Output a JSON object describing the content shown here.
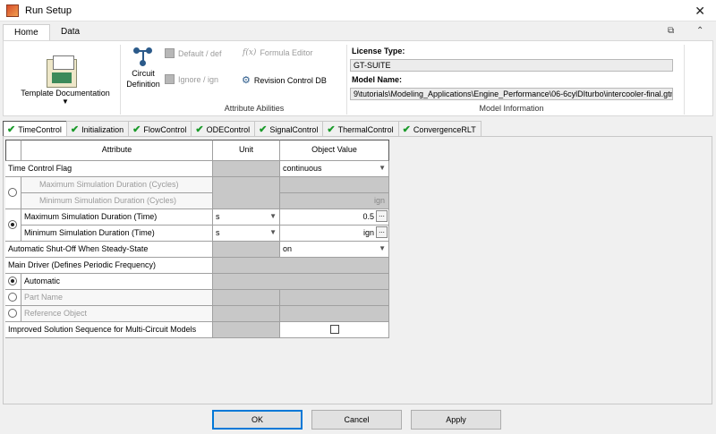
{
  "window": {
    "title": "Run Setup"
  },
  "ribbon_tabs": [
    {
      "label": "Home"
    },
    {
      "label": "Data"
    }
  ],
  "ribbon": {
    "template_doc": "Template Documentation",
    "circuit_def_line1": "Circuit",
    "circuit_def_line2": "Definition",
    "default_def": "Default / def",
    "ignore_ign": "Ignore / ign",
    "formula_editor": "Formula Editor",
    "revision_control": "Revision Control DB",
    "attribute_abilities": "Attribute Abilities",
    "license_type_label": "License Type:",
    "license_type_value": "GT-SUITE",
    "model_name_label": "Model Name:",
    "model_name_value": "9\\tutorials\\Modeling_Applications\\Engine_Performance\\06-6cylDIturbo\\intercooler-final.gtm",
    "model_information": "Model Information"
  },
  "subtabs": [
    {
      "label": "TimeControl"
    },
    {
      "label": "Initialization"
    },
    {
      "label": "FlowControl"
    },
    {
      "label": "ODEControl"
    },
    {
      "label": "SignalControl"
    },
    {
      "label": "ThermalControl"
    },
    {
      "label": "ConvergenceRLT"
    }
  ],
  "table": {
    "headers": {
      "attribute": "Attribute",
      "unit": "Unit",
      "value": "Object Value"
    },
    "rows": {
      "time_control_flag": {
        "label": "Time Control Flag",
        "value": "continuous"
      },
      "max_sim_cycles": {
        "label": "Maximum Simulation Duration (Cycles)"
      },
      "min_sim_cycles": {
        "label": "Minimum Simulation Duration (Cycles)",
        "value": "ign"
      },
      "max_sim_time": {
        "label": "Maximum Simulation Duration (Time)",
        "unit": "s",
        "value": "0.5"
      },
      "min_sim_time": {
        "label": "Minimum Simulation Duration (Time)",
        "unit": "s",
        "value": "ign"
      },
      "auto_shutoff": {
        "label": "Automatic Shut-Off When Steady-State",
        "value": "on"
      },
      "main_driver": {
        "label": "Main Driver (Defines Periodic Frequency)"
      },
      "automatic": {
        "label": "Automatic"
      },
      "part_name": {
        "label": "Part Name"
      },
      "reference_object": {
        "label": "Reference Object"
      },
      "improved_solution": {
        "label": "Improved Solution Sequence for Multi-Circuit Models",
        "checked": false
      }
    },
    "dots": "..."
  },
  "buttons": {
    "ok": "OK",
    "cancel": "Cancel",
    "apply": "Apply"
  }
}
